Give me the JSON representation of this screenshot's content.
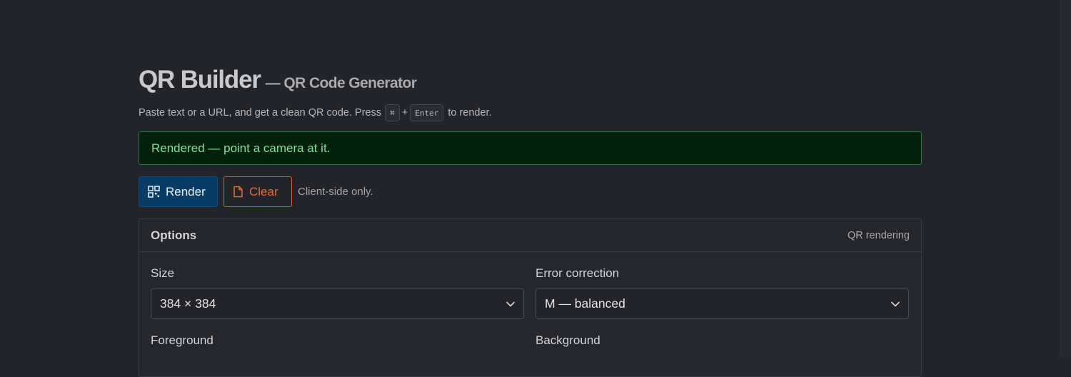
{
  "header": {
    "title": "QR Builder",
    "subtitle": "— QR Code Generator",
    "hint_before": "Paste text or a URL, and get a clean QR code. Press",
    "hint_key1": "⌘",
    "hint_plus": "+",
    "hint_key2": "Enter",
    "hint_after": "to render."
  },
  "alert": {
    "text": "Rendered — point a camera at it."
  },
  "actions": {
    "render_label": "Render",
    "clear_label": "Clear",
    "note": "Client-side only."
  },
  "options": {
    "title": "Options",
    "meta": "QR rendering",
    "size_label": "Size",
    "size_value": "384 × 384",
    "ec_label": "Error correction",
    "ec_value": "M — balanced",
    "fg_label": "Foreground",
    "bg_label": "Background"
  },
  "icons": {
    "render": "qr-code-icon",
    "clear": "file-icon",
    "select": "chevron-down-icon"
  },
  "colors": {
    "background": "#232429",
    "primary": "#0a3d66",
    "danger": "#e86a3a",
    "success_text": "#7fe39a",
    "success_bg": "#03200c"
  }
}
